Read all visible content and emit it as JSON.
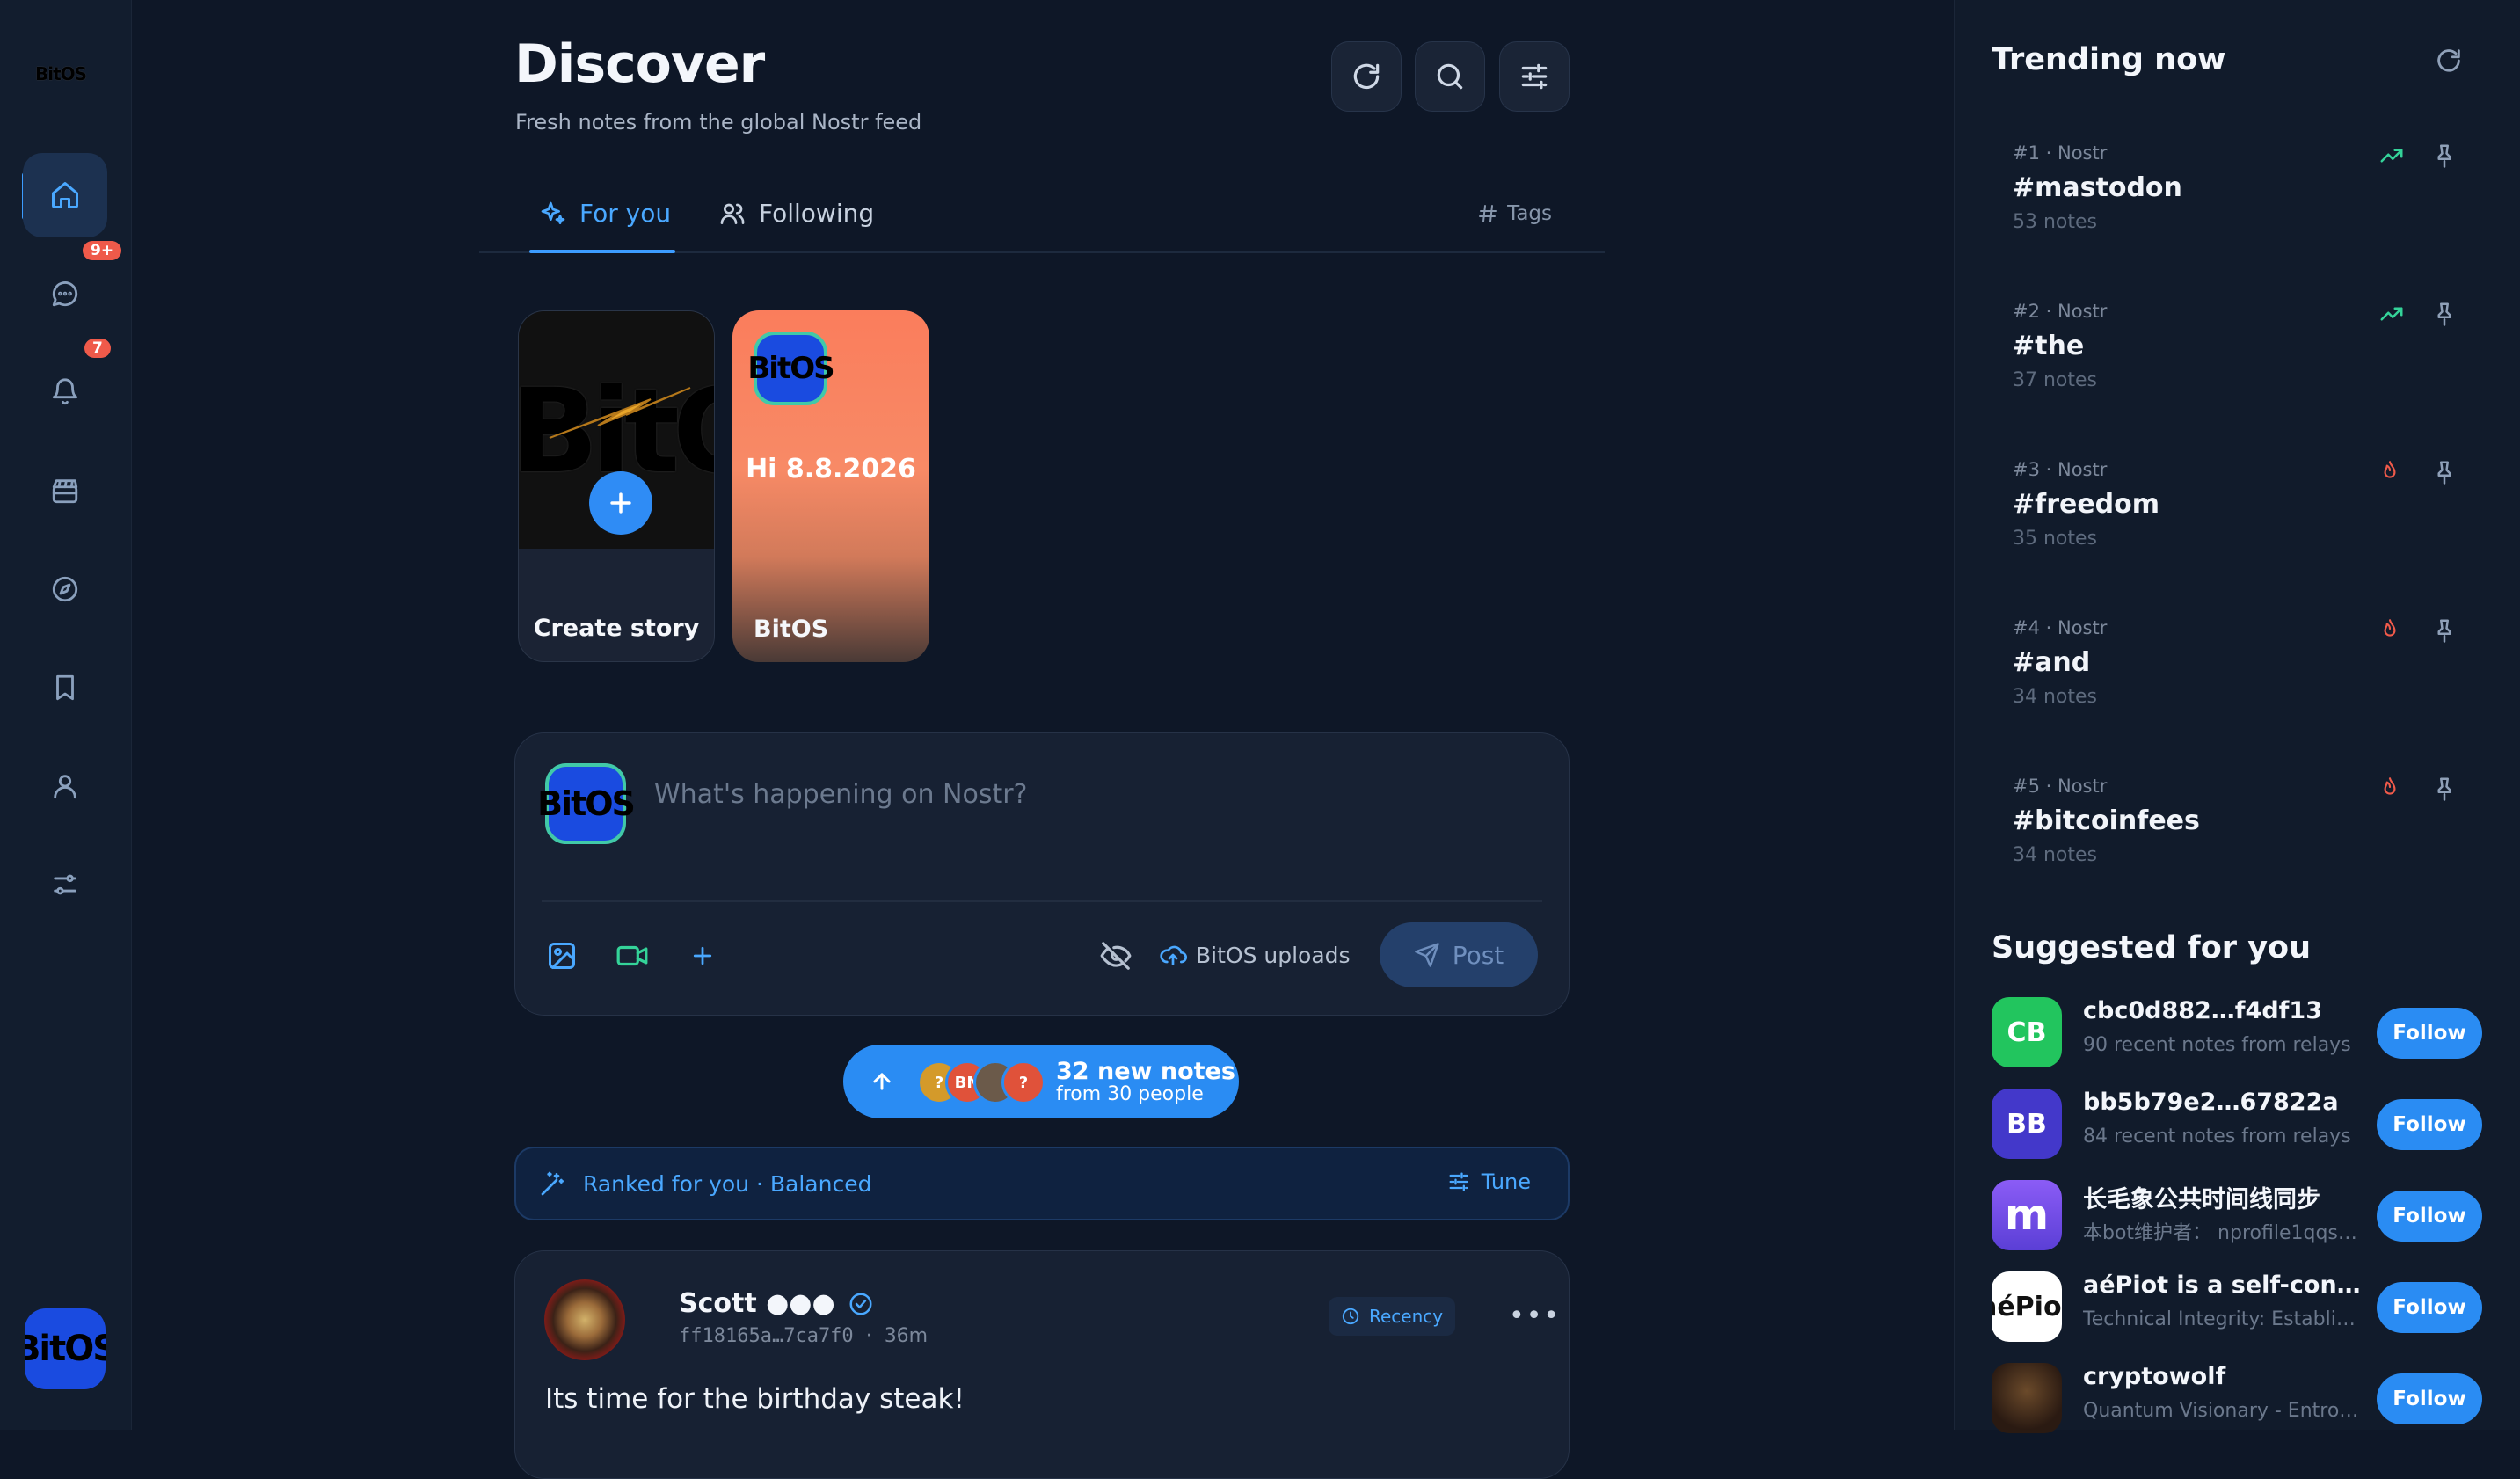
{
  "app": {
    "logo_text": "BitOS"
  },
  "rail": {
    "badges": {
      "messages": "9+",
      "notifications": "7"
    },
    "avatar_text": "BitOS"
  },
  "header": {
    "title": "Discover",
    "subtitle": "Fresh notes from the global Nostr feed"
  },
  "tabs": {
    "for_you": "For you",
    "following": "Following",
    "tags": "Tags"
  },
  "stories": {
    "create_label": "Create story",
    "banner_text": "BitOS",
    "user": {
      "avatar_text": "BitOS",
      "text": "Hi 8.8.2026",
      "label": "BitOS"
    }
  },
  "composer": {
    "avatar_text": "BitOS",
    "placeholder": "What's happening on Nostr?",
    "uploads_label": "BitOS uploads",
    "post_label": "Post"
  },
  "new_notes": {
    "main": "32 new notes",
    "sub": "from 30 people",
    "avatars": [
      {
        "text": "?",
        "color": "#d49a2a"
      },
      {
        "text": "BN",
        "color": "#e0523a"
      },
      {
        "text": "",
        "color": "#6b5a4a"
      },
      {
        "text": "?",
        "color": "#e0523a"
      }
    ]
  },
  "ranked": {
    "label": "Ranked for you · Balanced",
    "tune": "Tune"
  },
  "post": {
    "name": "Scott ●●●",
    "pubkey": "ff18165a…7ca7f0",
    "dot": "·",
    "age": "36m",
    "badge": "Recency",
    "more": "•••",
    "body": "Its time for the birthday steak!"
  },
  "trending": {
    "title": "Trending now",
    "items": [
      {
        "rank": "#1 · Nostr",
        "tag": "#mastodon",
        "count": "53 notes",
        "indicator": "up"
      },
      {
        "rank": "#2 · Nostr",
        "tag": "#the",
        "count": "37 notes",
        "indicator": "up"
      },
      {
        "rank": "#3 · Nostr",
        "tag": "#freedom",
        "count": "35 notes",
        "indicator": "fire"
      },
      {
        "rank": "#4 · Nostr",
        "tag": "#and",
        "count": "34 notes",
        "indicator": "fire"
      },
      {
        "rank": "#5 · Nostr",
        "tag": "#bitcoinfees",
        "count": "34 notes",
        "indicator": "fire"
      }
    ]
  },
  "suggested": {
    "title": "Suggested for you",
    "follow_label": "Follow",
    "items": [
      {
        "avatar": "CB",
        "color": "#22c55e",
        "name": "cbc0d882…f4df13",
        "desc": "90 recent notes from relays"
      },
      {
        "avatar": "BB",
        "color": "#4338ca",
        "name": "bb5b79e2…67822a",
        "desc": "84 recent notes from relays"
      },
      {
        "avatar": "m",
        "color": "#7c4dff",
        "name": "长毛象公共时间线同步",
        "desc": "本bot维护者： nprofile1qqsd..."
      },
      {
        "avatar": "aéPiot",
        "color": "#ffffff",
        "name": "aéPiot is a self-contain...",
        "desc": "Technical Integrity: Establish..."
      },
      {
        "avatar": "",
        "color": "#3a2a20",
        "name": "cryptowolf",
        "desc": "Quantum Visionary - Entrop..."
      }
    ]
  },
  "colors": {
    "accent": "#3c9cff",
    "background": "#0e1727",
    "badge": "#ef5a4a",
    "trend_up": "#34d399",
    "trend_fire": "#f05a4a"
  }
}
